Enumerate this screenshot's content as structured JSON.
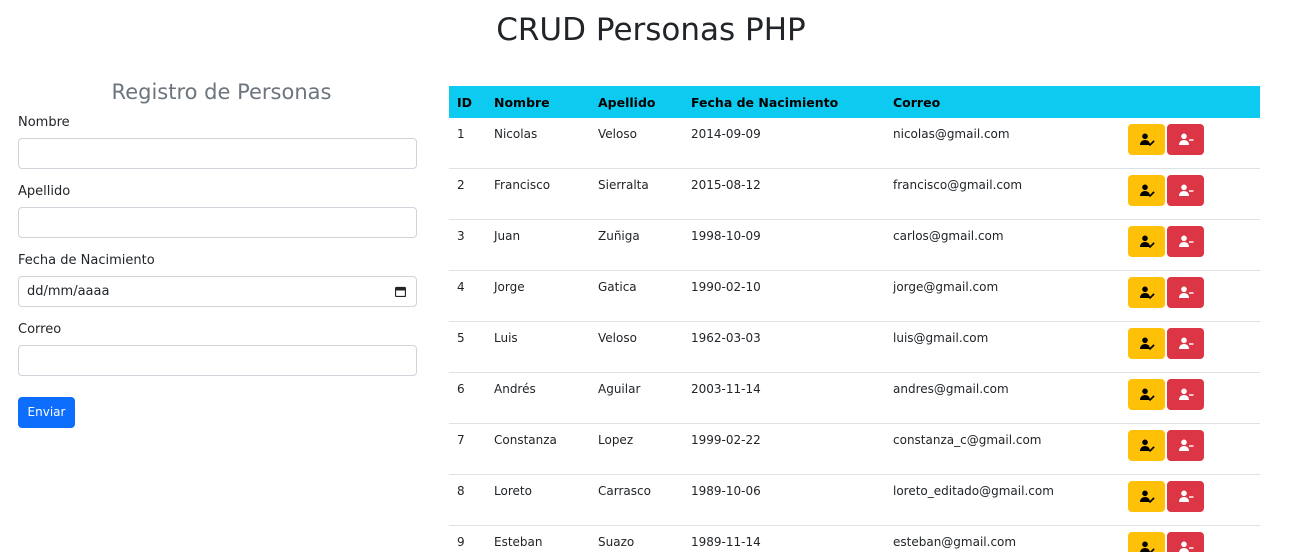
{
  "page": {
    "title": "CRUD Personas PHP"
  },
  "form": {
    "title": "Registro de Personas",
    "fields": {
      "nombre": {
        "label": "Nombre",
        "value": ""
      },
      "apellido": {
        "label": "Apellido",
        "value": ""
      },
      "fecha": {
        "label": "Fecha de Nacimiento",
        "placeholder": "dd/mm/aaaa"
      },
      "correo": {
        "label": "Correo",
        "value": ""
      }
    },
    "submit_label": "Enviar",
    "submit_color": "#0d6efd"
  },
  "table": {
    "header_color": "#0dcaf0",
    "columns": [
      "ID",
      "Nombre",
      "Apellido",
      "Fecha de Nacimiento",
      "Correo",
      ""
    ],
    "edit_icon": "user-edit-icon",
    "delete_icon": "user-minus-icon",
    "edit_color": "#ffc107",
    "delete_color": "#dc3545",
    "rows": [
      {
        "id": "1",
        "nombre": "Nicolas",
        "apellido": "Veloso",
        "fecha": "2014-09-09",
        "correo": "nicolas@gmail.com"
      },
      {
        "id": "2",
        "nombre": "Francisco",
        "apellido": "Sierralta",
        "fecha": "2015-08-12",
        "correo": "francisco@gmail.com"
      },
      {
        "id": "3",
        "nombre": "Juan",
        "apellido": "Zuñiga",
        "fecha": "1998-10-09",
        "correo": "carlos@gmail.com"
      },
      {
        "id": "4",
        "nombre": "Jorge",
        "apellido": "Gatica",
        "fecha": "1990-02-10",
        "correo": "jorge@gmail.com"
      },
      {
        "id": "5",
        "nombre": "Luis",
        "apellido": "Veloso",
        "fecha": "1962-03-03",
        "correo": "luis@gmail.com"
      },
      {
        "id": "6",
        "nombre": "Andrés",
        "apellido": "Aguilar",
        "fecha": "2003-11-14",
        "correo": "andres@gmail.com"
      },
      {
        "id": "7",
        "nombre": "Constanza",
        "apellido": "Lopez",
        "fecha": "1999-02-22",
        "correo": "constanza_c@gmail.com"
      },
      {
        "id": "8",
        "nombre": "Loreto",
        "apellido": "Carrasco",
        "fecha": "1989-10-06",
        "correo": "loreto_editado@gmail.com"
      },
      {
        "id": "9",
        "nombre": "Esteban",
        "apellido": "Suazo",
        "fecha": "1989-11-14",
        "correo": "esteban@gmail.com"
      }
    ]
  }
}
